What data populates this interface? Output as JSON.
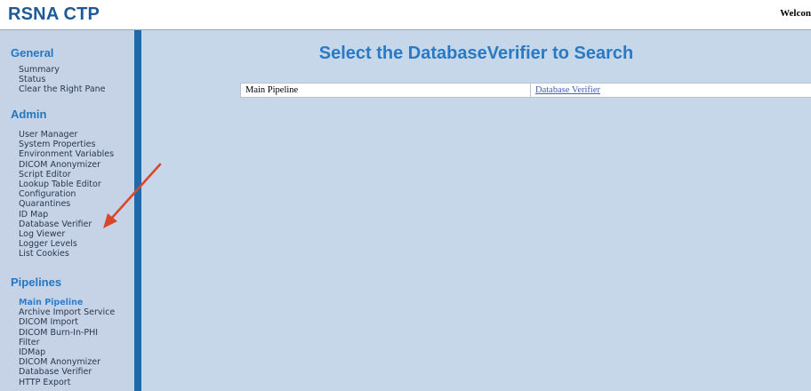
{
  "header": {
    "title": "RSNA CTP",
    "welcome": "Welcon"
  },
  "sidebar": {
    "general": {
      "title": "General",
      "items": [
        "Summary",
        "Status",
        "Clear the Right Pane"
      ]
    },
    "admin": {
      "title": "Admin",
      "items": [
        "User Manager",
        "System Properties",
        "Environment Variables",
        "DICOM Anonymizer",
        "Script Editor",
        "Lookup Table Editor",
        "Configuration",
        "Quarantines",
        "ID Map",
        "Database Verifier",
        "Log Viewer",
        "Logger Levels",
        "List Cookies"
      ]
    },
    "pipelines": {
      "title": "Pipelines",
      "items": [
        "Main Pipeline",
        "Archive Import Service",
        "DICOM Import",
        "DICOM Burn-In-PHI",
        "Filter",
        "IDMap",
        "DICOM Anonymizer",
        "Database Verifier",
        "HTTP Export"
      ]
    }
  },
  "main": {
    "title": "Select the DatabaseVerifier to Search",
    "table": {
      "rows": [
        {
          "pipeline": "Main Pipeline",
          "stage": "Database Verifier"
        }
      ]
    }
  },
  "annotation": {
    "arrow_color": "#d9472a"
  }
}
